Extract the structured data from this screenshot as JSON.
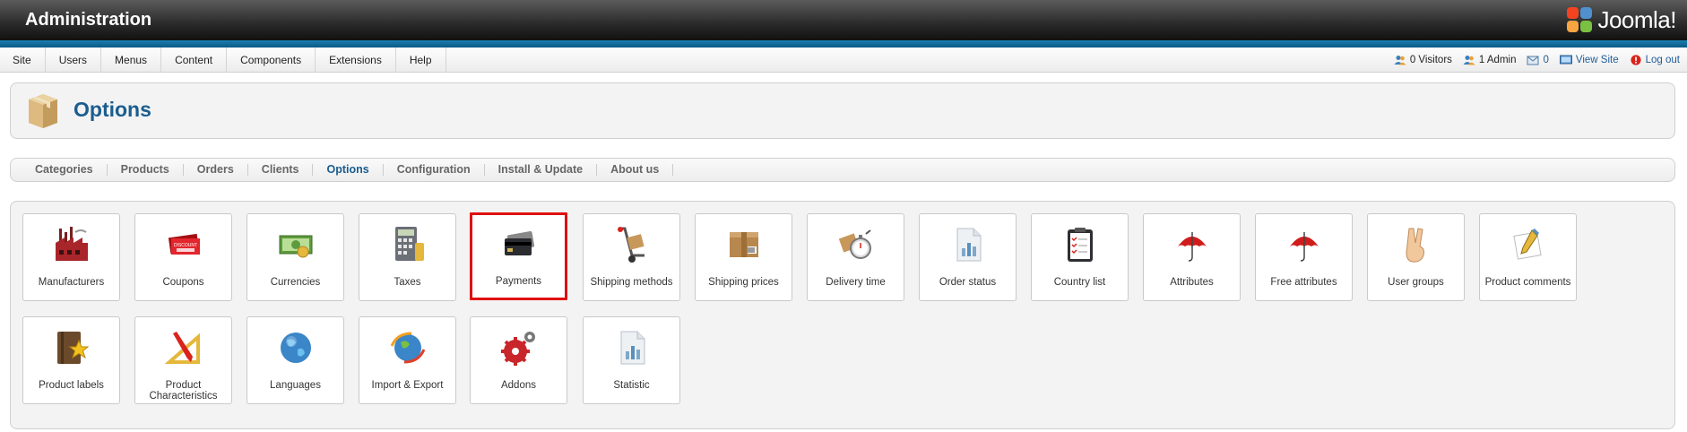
{
  "header": {
    "title": "Administration",
    "brand": "Joomla!"
  },
  "menu": [
    "Site",
    "Users",
    "Menus",
    "Content",
    "Components",
    "Extensions",
    "Help"
  ],
  "status": {
    "visitors": "0 Visitors",
    "admins": "1 Admin",
    "messages": "0",
    "view_site": "View Site",
    "logout": "Log out"
  },
  "page": {
    "title": "Options"
  },
  "submenu": {
    "items": [
      "Categories",
      "Products",
      "Orders",
      "Clients",
      "Options",
      "Configuration",
      "Install & Update",
      "About us"
    ],
    "active": "Options"
  },
  "tiles": [
    {
      "label": "Manufacturers",
      "icon": "factory-icon"
    },
    {
      "label": "Coupons",
      "icon": "coupon-icon"
    },
    {
      "label": "Currencies",
      "icon": "money-icon"
    },
    {
      "label": "Taxes",
      "icon": "calculator-icon"
    },
    {
      "label": "Payments",
      "icon": "credit-card-icon",
      "selected": true
    },
    {
      "label": "Shipping methods",
      "icon": "hand-truck-icon"
    },
    {
      "label": "Shipping prices",
      "icon": "package-icon"
    },
    {
      "label": "Delivery time",
      "icon": "stopwatch-icon"
    },
    {
      "label": "Order status",
      "icon": "document-chart-icon"
    },
    {
      "label": "Country list",
      "icon": "clipboard-icon"
    },
    {
      "label": "Attributes",
      "icon": "umbrella-icon"
    },
    {
      "label": "Free attributes",
      "icon": "umbrella-icon"
    },
    {
      "label": "User groups",
      "icon": "victory-hand-icon"
    },
    {
      "label": "Product comments",
      "icon": "note-pencil-icon"
    },
    {
      "label": "Product labels",
      "icon": "star-book-icon"
    },
    {
      "label": "Product Characteristics",
      "icon": "pencil-ruler-icon"
    },
    {
      "label": "Languages",
      "icon": "globe-icon"
    },
    {
      "label": "Import & Export",
      "icon": "globe-arrows-icon"
    },
    {
      "label": "Addons",
      "icon": "gears-icon"
    },
    {
      "label": "Statistic",
      "icon": "document-chart-icon"
    }
  ],
  "colors": {
    "accent": "#1a5d8f",
    "selection": "#e01010",
    "header_stripe": "#0b5a86"
  }
}
